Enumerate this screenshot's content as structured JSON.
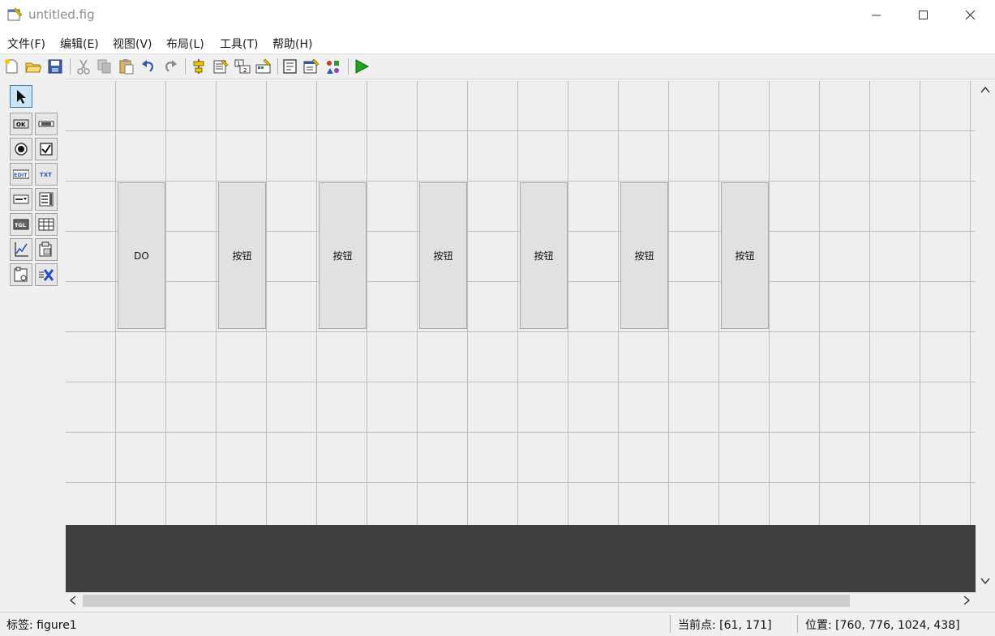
{
  "window": {
    "title": "untitled.fig"
  },
  "menu": [
    "文件(F)",
    "编辑(E)",
    "视图(V)",
    "布局(L)",
    "工具(T)",
    "帮助(H)"
  ],
  "toolbar": {
    "icons": [
      "new-file-icon",
      "open-folder-icon",
      "save-icon",
      "cut-icon",
      "copy-icon",
      "paste-icon",
      "undo-icon",
      "redo-icon",
      "align-icon",
      "menu-editor-icon",
      "tab-order-icon",
      "toolbar-editor-icon",
      "editor-icon",
      "property-inspector-icon",
      "object-browser-icon",
      "run-icon"
    ]
  },
  "palette": {
    "icons": [
      "select-arrow-icon",
      "push-button-icon",
      "slider-icon",
      "radio-button-icon",
      "checkbox-icon",
      "edit-text-icon",
      "static-text-icon",
      "popup-menu-icon",
      "listbox-icon",
      "toggle-button-icon",
      "table-icon",
      "axes-icon",
      "panel-icon",
      "button-group-icon",
      "activex-icon"
    ],
    "labels": {
      "ok": "OK",
      "edit": "EDIT",
      "txt": "TXT",
      "tgl": "TGL"
    }
  },
  "canvas": {
    "buttons": [
      "DO",
      "按钮",
      "按钮",
      "按钮",
      "按钮",
      "按钮",
      "按钮"
    ],
    "button_bg": "#e1e1e1",
    "dark_area_color": "#404040"
  },
  "status": {
    "tag": "标签: figure1",
    "current_point": "当前点:  [61, 171]",
    "position": "位置: [760, 776, 1024, 438]"
  },
  "colors": {
    "run": "#1fa31f",
    "title": "#8c8c8c"
  }
}
